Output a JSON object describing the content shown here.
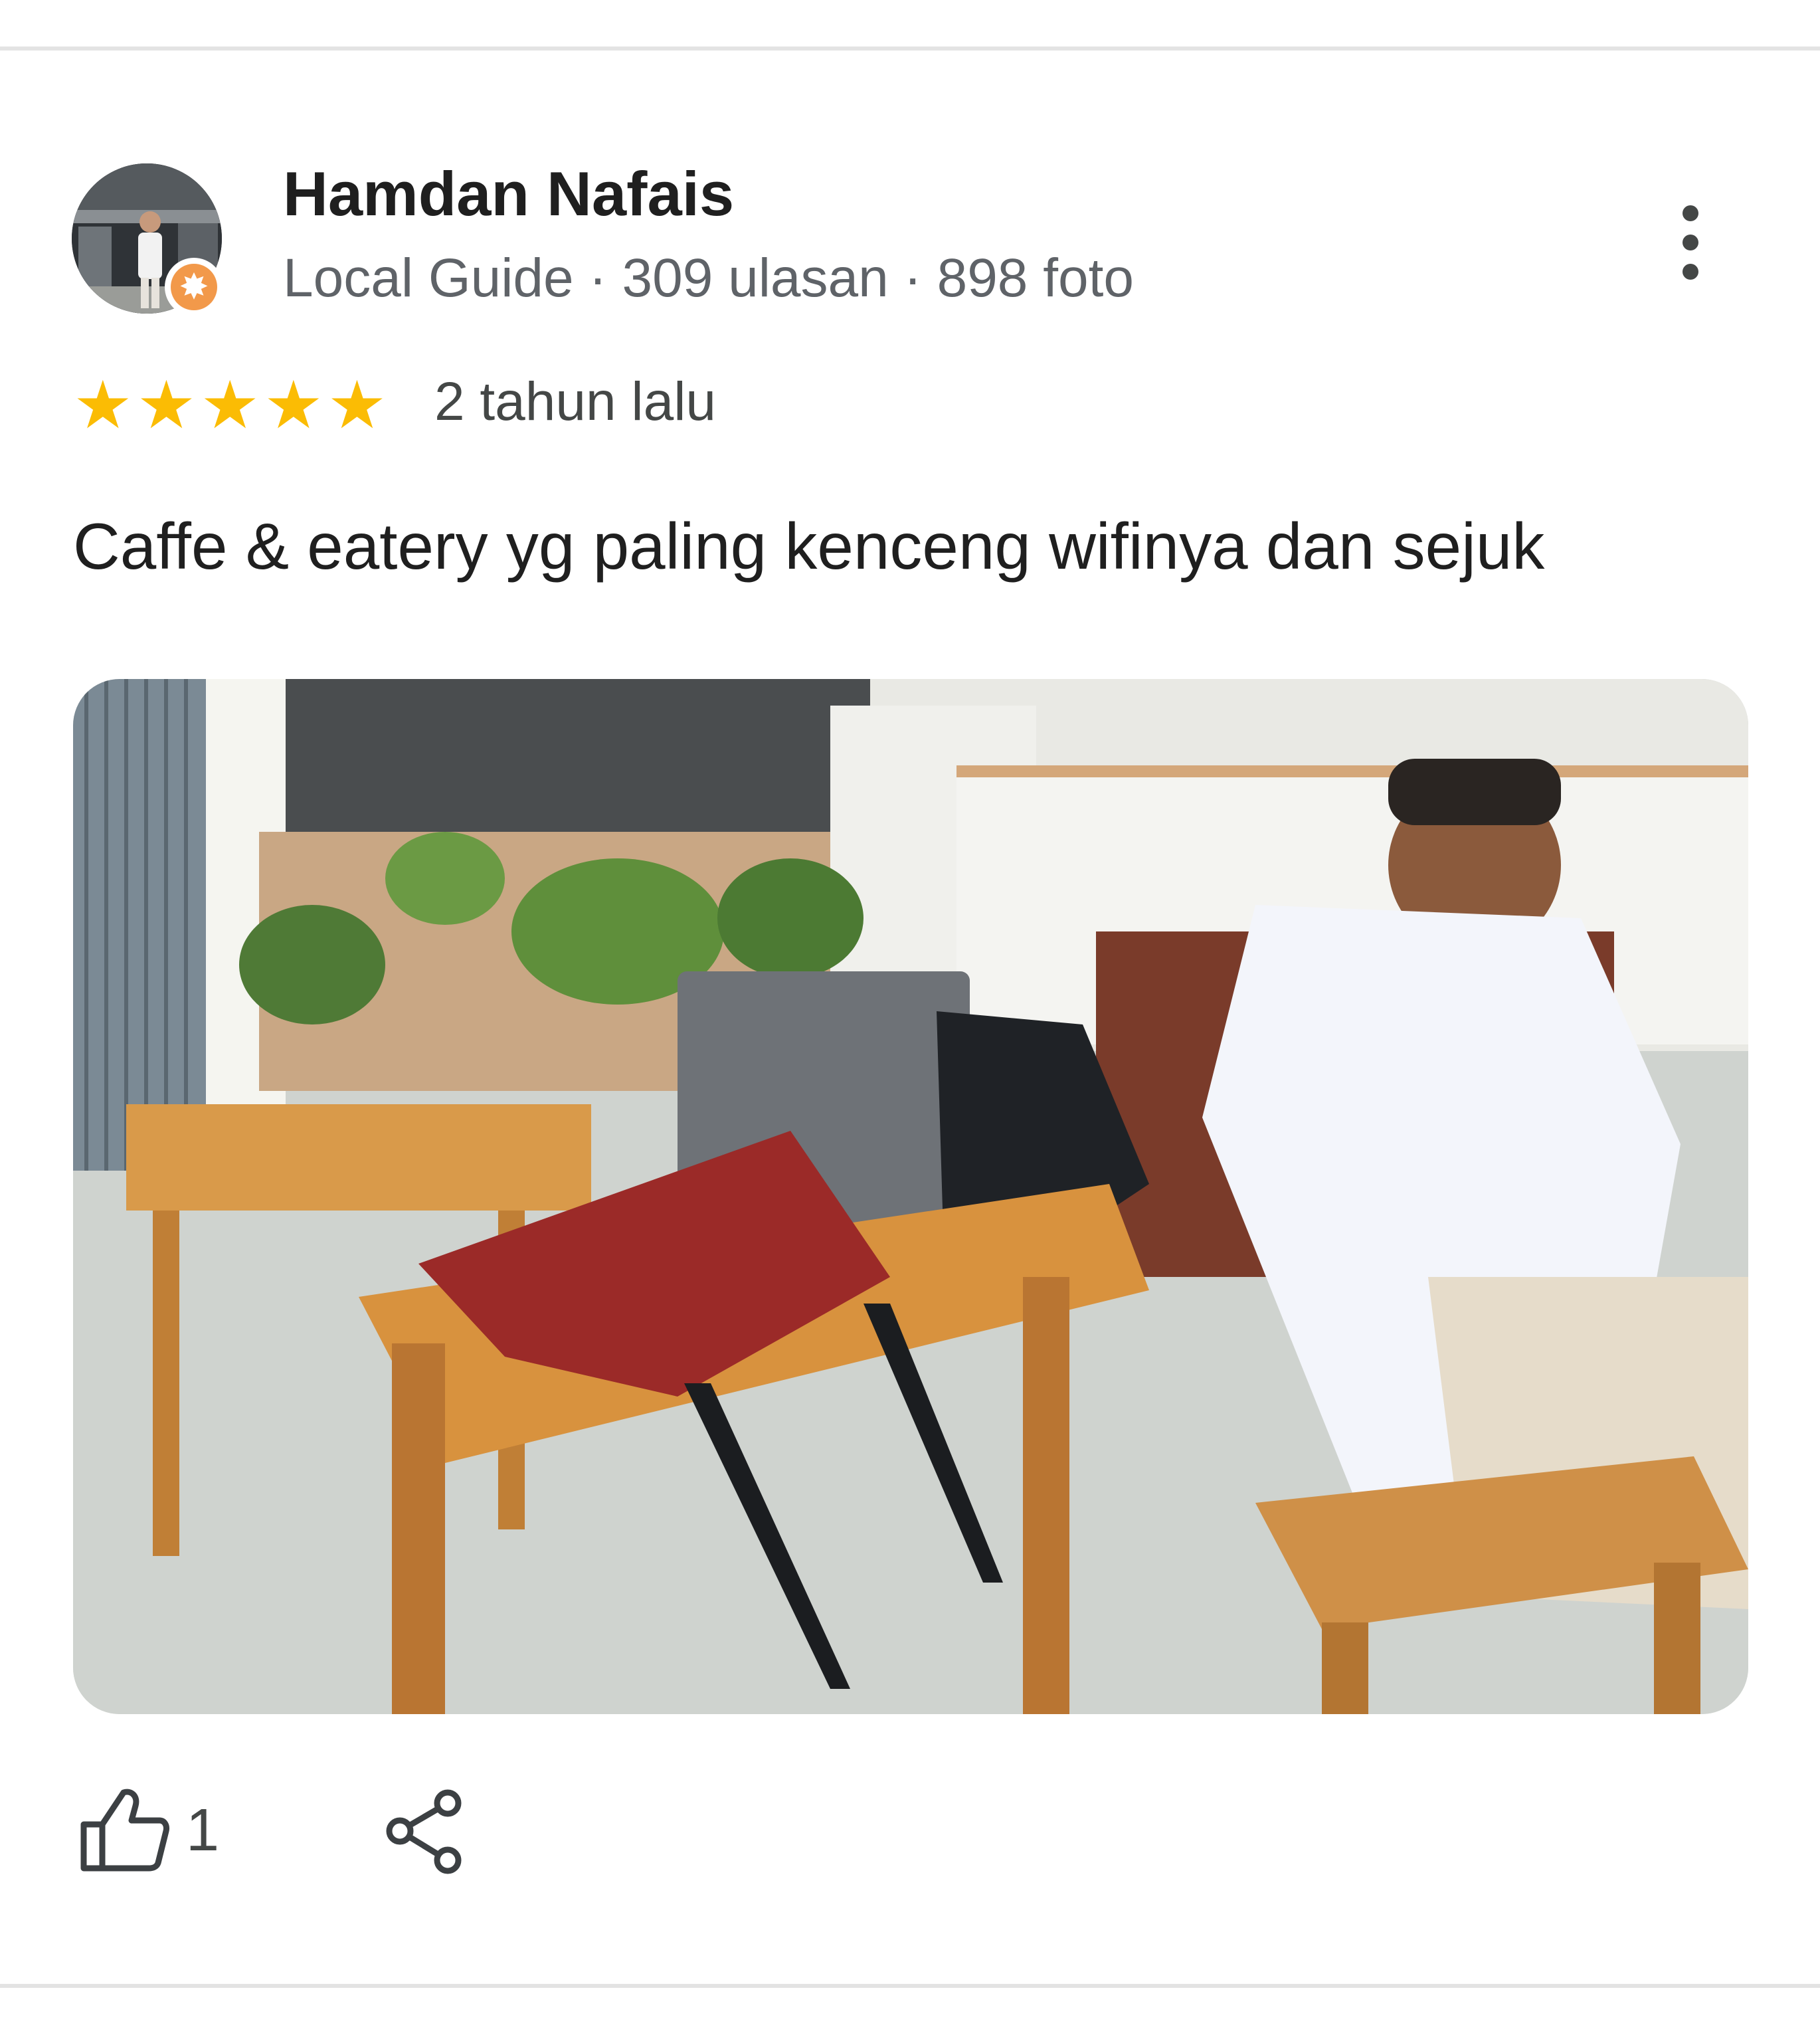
{
  "review": {
    "author": {
      "name": "Hamdan Nafais",
      "meta": "Local Guide · 309 ulasan · 898 foto",
      "avatar_icon": "profile-photo",
      "badge_icon": "local-guide-badge-icon"
    },
    "rating": {
      "stars": 5,
      "max_stars": 5,
      "star_color": "#fbbc04",
      "star_glyph": "★"
    },
    "age": "2 tahun lalu",
    "text": "Caffe & eatery yg paling kenceng wifinya dan sejuk",
    "photo": {
      "description_icon": "review-photo"
    },
    "actions": {
      "like_icon": "thumbs-up-icon",
      "like_count": "1",
      "share_icon": "share-icon",
      "more_icon": "more-vertical-icon"
    }
  }
}
